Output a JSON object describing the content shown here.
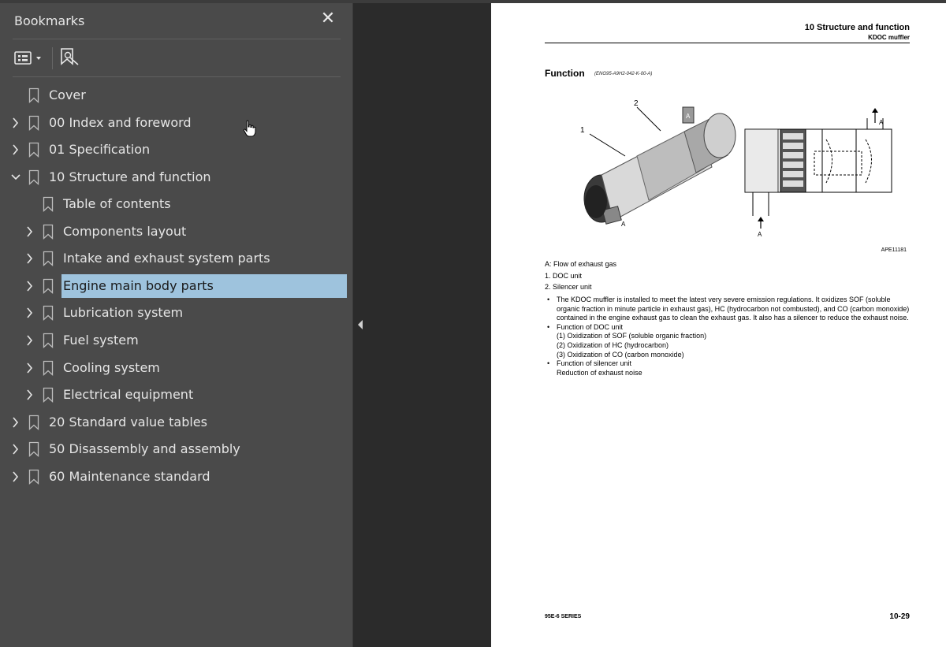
{
  "sidebar": {
    "title": "Bookmarks",
    "close_glyph": "✕",
    "items": [
      {
        "label": "Cover"
      },
      {
        "label": "00 Index and foreword"
      },
      {
        "label": "01 Specification"
      },
      {
        "label": "10 Structure and function"
      },
      {
        "label": "Table of contents"
      },
      {
        "label": "Components layout"
      },
      {
        "label": "Intake and exhaust system parts"
      },
      {
        "label": "Engine main body parts"
      },
      {
        "label": "Lubrication system"
      },
      {
        "label": "Fuel system"
      },
      {
        "label": "Cooling system"
      },
      {
        "label": "Electrical equipment"
      },
      {
        "label": "20 Standard value tables"
      },
      {
        "label": "50 Disassembly and assembly"
      },
      {
        "label": "60 Maintenance standard"
      }
    ]
  },
  "document": {
    "header_title": "10 Structure and function",
    "header_subtitle": "KDOC muffler",
    "section_title": "Function",
    "section_code": "(ENG95-A9H2-042-K-00-A)",
    "figure_labels": {
      "one": "1",
      "two": "2",
      "a": "A"
    },
    "figure_id": "APE11181",
    "legend": [
      "A: Flow of exhaust gas",
      "1. DOC unit",
      "2. Silencer unit"
    ],
    "bullets": [
      {
        "lines": [
          "The KDOC muffler is installed to meet the latest very severe emission regulations. It oxidizes SOF (soluble organic fraction in minute particle in exhaust gas), HC (hydrocarbon not combusted), and CO (carbon monoxide) contained in the engine exhaust gas to clean the exhaust gas. It also has a silencer to reduce the exhaust noise."
        ]
      },
      {
        "lines": [
          "Function of DOC unit",
          "(1) Oxidization of SOF (soluble organic fraction)",
          "(2) Oxidization of HC (hydrocarbon)",
          "(3) Oxidization of CO (carbon monoxide)"
        ]
      },
      {
        "lines": [
          "Function of silencer unit",
          "Reduction of exhaust noise"
        ]
      }
    ],
    "footer_left": "95E-6 SERIES",
    "footer_right": "10-29"
  }
}
